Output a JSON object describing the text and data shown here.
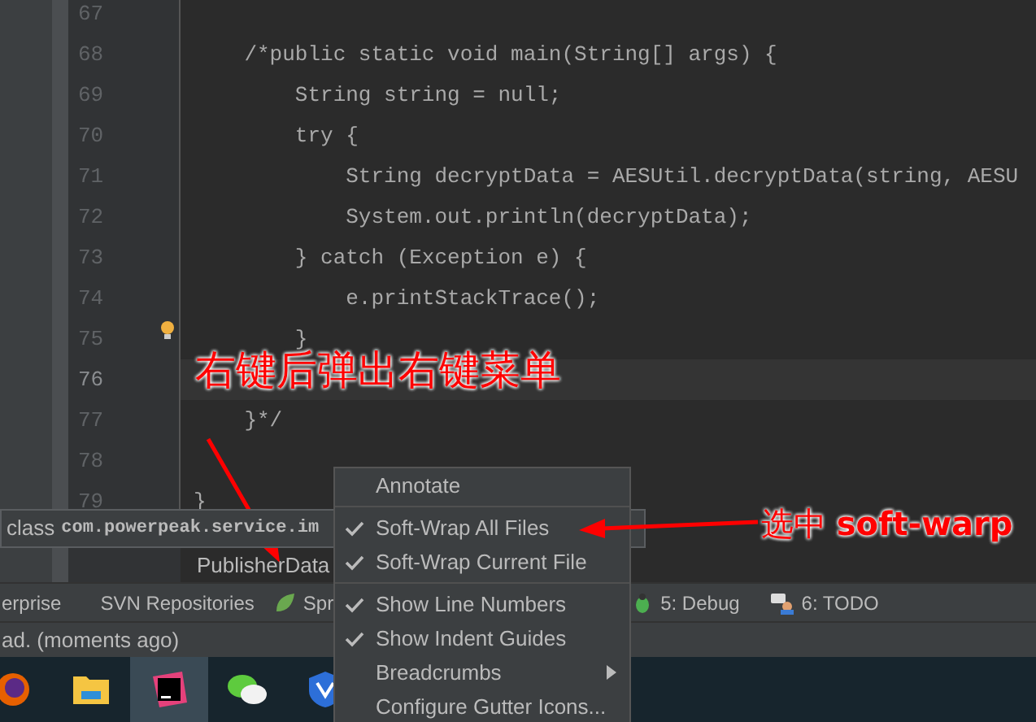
{
  "editor": {
    "lines": [
      {
        "number": "67",
        "current": false
      },
      {
        "number": "68",
        "code": "    /*public static void main(String[] args) {",
        "current": false
      },
      {
        "number": "69",
        "code": "        String string = null;",
        "current": false
      },
      {
        "number": "70",
        "code": "        try {",
        "current": false
      },
      {
        "number": "71",
        "code": "            String decryptData = AESUtil.decryptData(string, AESU",
        "current": false
      },
      {
        "number": "72",
        "code": "            System.out.println(decryptData);",
        "current": false
      },
      {
        "number": "73",
        "code": "        } catch (Exception e) {",
        "current": false
      },
      {
        "number": "74",
        "code": "            e.printStackTrace();",
        "current": false
      },
      {
        "number": "75",
        "code": "        }",
        "current": false,
        "intention": true
      },
      {
        "number": "76",
        "current": true
      },
      {
        "number": "77",
        "code": "    }*/",
        "current": false
      },
      {
        "number": "78",
        "current": false
      },
      {
        "number": "79",
        "code": "}",
        "current": false
      }
    ]
  },
  "tooltip": {
    "prefix": "class",
    "name": "com.powerpeak.service.im"
  },
  "breadcrumb": "PublisherData",
  "tool_windows": [
    {
      "label": "erprise",
      "kind": "plain"
    },
    {
      "label": "SVN Repositories",
      "kind": "plain"
    },
    {
      "label": "Spr",
      "kind": "leaf"
    },
    {
      "label": "5: Debug",
      "kind": "bug"
    },
    {
      "label": "6: TODO",
      "kind": "todo"
    }
  ],
  "status_bar": {
    "text": "ad. (moments ago)"
  },
  "taskbar": {
    "apps": [
      {
        "kind": "browser",
        "selected": false
      },
      {
        "kind": "folder",
        "selected": false
      },
      {
        "kind": "ide",
        "selected": true
      },
      {
        "kind": "chat",
        "selected": false
      },
      {
        "kind": "shield",
        "selected": false
      }
    ]
  },
  "context_menu": {
    "groups": [
      [
        {
          "label": "Annotate",
          "checked": false,
          "submenu": false
        }
      ],
      [
        {
          "label": "Soft-Wrap All Files",
          "checked": true,
          "submenu": false
        },
        {
          "label": "Soft-Wrap Current File",
          "checked": true,
          "submenu": false
        }
      ],
      [
        {
          "label": "Show Line Numbers",
          "checked": true,
          "submenu": false
        },
        {
          "label": "Show Indent Guides",
          "checked": true,
          "submenu": false
        },
        {
          "label": "Breadcrumbs",
          "checked": false,
          "submenu": true
        },
        {
          "label": "Configure Gutter Icons...",
          "checked": false,
          "submenu": false
        }
      ]
    ]
  },
  "annotations": [
    {
      "text": "右键后弹出右键菜单"
    },
    {
      "text": "选中 **soft-warp**"
    }
  ]
}
